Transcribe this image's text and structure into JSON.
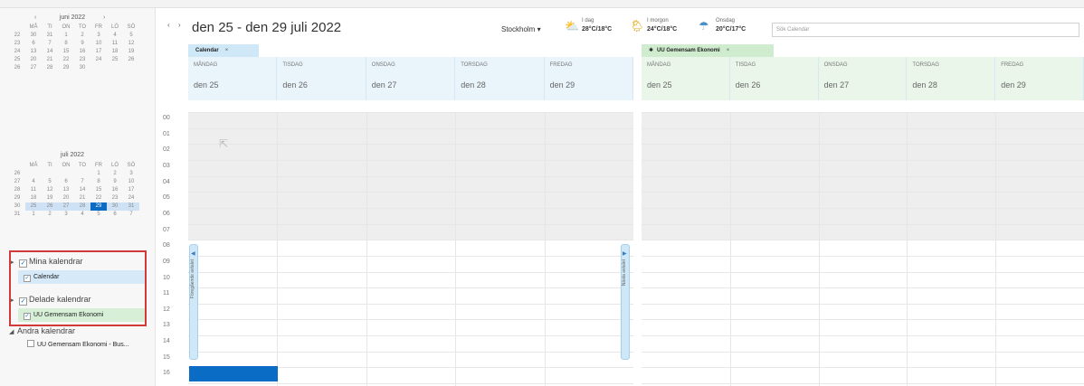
{
  "mini_calendar_june": {
    "month": "juni 2022",
    "prev": "‹",
    "next": "›",
    "weekdays": [
      "",
      "MÅ",
      "TI",
      "ON",
      "TO",
      "FR",
      "LÖ",
      "SÖ"
    ],
    "weeks": [
      [
        "22",
        "30",
        "31",
        "1",
        "2",
        "3",
        "4",
        "5"
      ],
      [
        "23",
        "6",
        "7",
        "8",
        "9",
        "10",
        "11",
        "12"
      ],
      [
        "24",
        "13",
        "14",
        "15",
        "16",
        "17",
        "18",
        "19"
      ],
      [
        "25",
        "20",
        "21",
        "22",
        "23",
        "24",
        "25",
        "26"
      ],
      [
        "26",
        "27",
        "28",
        "29",
        "30",
        "",
        "",
        ""
      ]
    ]
  },
  "mini_calendar_july": {
    "month": "juli 2022",
    "weekdays": [
      "",
      "MÅ",
      "TI",
      "ON",
      "TO",
      "FR",
      "LÖ",
      "SÖ"
    ],
    "weeks": [
      [
        "26",
        "",
        "",
        "",
        "",
        "1",
        "2",
        "3"
      ],
      [
        "27",
        "4",
        "5",
        "6",
        "7",
        "8",
        "9",
        "10"
      ],
      [
        "28",
        "11",
        "12",
        "13",
        "14",
        "15",
        "16",
        "17"
      ],
      [
        "29",
        "18",
        "19",
        "20",
        "21",
        "22",
        "23",
        "24"
      ],
      [
        "30",
        "25",
        "26",
        "27",
        "28",
        "29",
        "30",
        "31"
      ],
      [
        "31",
        "1",
        "2",
        "3",
        "4",
        "5",
        "6",
        "7"
      ]
    ]
  },
  "calendar_groups": {
    "my_calendars": "Mina kalendrar",
    "calendar_item": "Calendar",
    "shared_calendars": "Delade kalendrar",
    "shared_item": "UU Gemensam Ekonomi",
    "other_calendars": "Andra kalendrar",
    "other_item": "UU Gemensam Ekonomi - Bus..."
  },
  "toolbar": {
    "prev_arrow": "‹",
    "next_arrow": "›",
    "date_range": "den 25 - den 29 juli 2022",
    "location": "Stockholm ▾"
  },
  "weather": [
    {
      "icon": "sun-cloud-icon",
      "glyph": "⛅",
      "label": "I dag",
      "temps": "28°C/18°C"
    },
    {
      "icon": "sun-rain-icon",
      "glyph": "🌦",
      "label": "I morgon",
      "temps": "24°C/18°C"
    },
    {
      "icon": "rain-icon",
      "glyph": "☂",
      "label": "Onsdag",
      "temps": "20°C/17°C"
    }
  ],
  "search": {
    "placeholder": "Sök Calendar"
  },
  "tabs": [
    {
      "label": "Calendar",
      "close": "×",
      "color": "#cfe8f7"
    },
    {
      "label": "UU Gemensam Ekonomi",
      "close": "×",
      "color": "#cfeccf"
    }
  ],
  "days": [
    {
      "name": "MÅNDAG",
      "date": "den 25"
    },
    {
      "name": "TISDAG",
      "date": "den 26"
    },
    {
      "name": "ONSDAG",
      "date": "den 27"
    },
    {
      "name": "TORSDAG",
      "date": "den 28"
    },
    {
      "name": "FREDAG",
      "date": "den 29"
    }
  ],
  "hours": [
    "00",
    "01",
    "02",
    "03",
    "04",
    "05",
    "06",
    "07",
    "08",
    "09",
    "10",
    "11",
    "12",
    "13",
    "14",
    "15",
    "16"
  ],
  "side_tabs": {
    "previous": "Föregående avtalet",
    "next": "Nästa avtalet"
  },
  "colors": {
    "accent": "#0a6cc4",
    "calendar_tab": "#cfe8f7",
    "shared_tab": "#cfeccf",
    "highlight_box": "#d23a3a"
  }
}
